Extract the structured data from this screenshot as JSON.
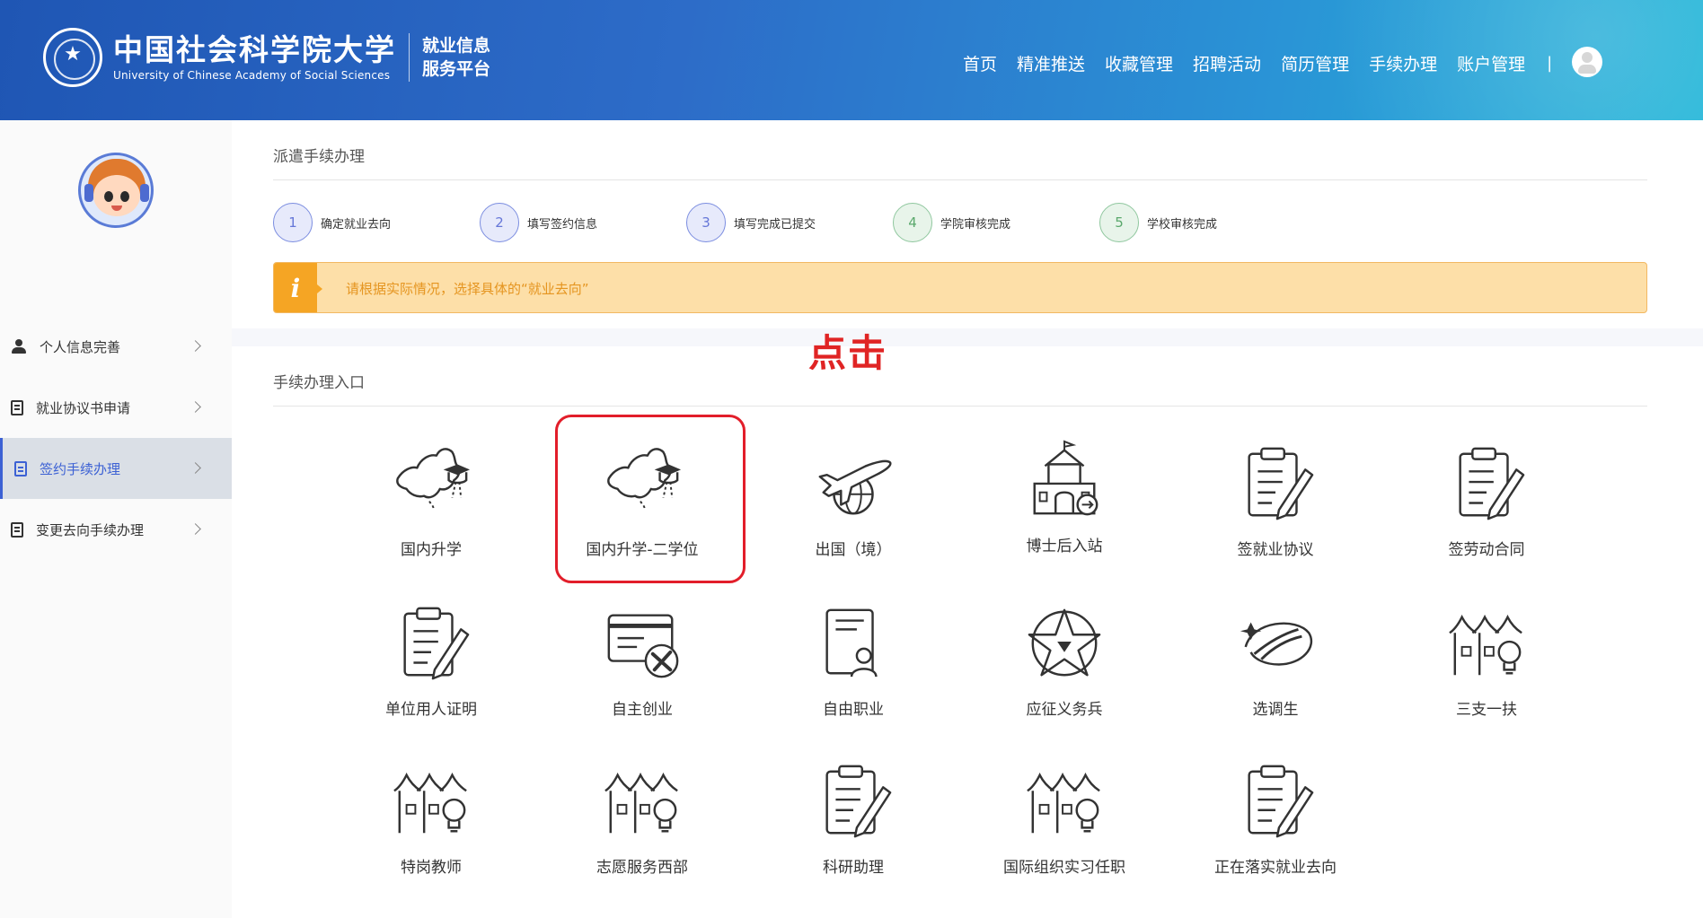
{
  "header": {
    "logo_cn": "中国社会科学院大学",
    "logo_en": "University of Chinese Academy of Social Sciences",
    "platform_line1": "就业信息",
    "platform_line2": "服务平台",
    "nav": [
      "首页",
      "精准推送",
      "收藏管理",
      "招聘活动",
      "简历管理",
      "手续办理",
      "账户管理"
    ],
    "separator": "|"
  },
  "sidebar": {
    "items": [
      {
        "label": "个人信息完善",
        "icon": "user-icon",
        "active": false
      },
      {
        "label": "就业协议书申请",
        "icon": "document-icon",
        "active": false
      },
      {
        "label": "签约手续办理",
        "icon": "clipboard-icon",
        "active": true
      },
      {
        "label": "变更去向手续办理",
        "icon": "document-icon",
        "active": false
      }
    ]
  },
  "dispatch": {
    "title": "派遣手续办理",
    "steps": [
      {
        "num": "1",
        "label": "确定就业去向",
        "status": "current"
      },
      {
        "num": "2",
        "label": "填写签约信息",
        "status": "current"
      },
      {
        "num": "3",
        "label": "填写完成已提交",
        "status": "current"
      },
      {
        "num": "4",
        "label": "学院审核完成",
        "status": "pending"
      },
      {
        "num": "5",
        "label": "学校审核完成",
        "status": "pending"
      }
    ],
    "alert_icon": "i",
    "alert_text": "请根据实际情况，选择具体的“就业去向”"
  },
  "annotation": {
    "click_text": "点击"
  },
  "entries": {
    "title": "手续办理入口",
    "items": [
      {
        "label": "国内升学",
        "icon": "china-map-graduation-icon"
      },
      {
        "label": "国内升学-二学位",
        "icon": "china-map-graduation-icon"
      },
      {
        "label": "出国（境）",
        "icon": "airplane-globe-icon"
      },
      {
        "label": "博士后入站",
        "icon": "institution-building-icon"
      },
      {
        "label": "签就业协议",
        "icon": "clipboard-pen-icon"
      },
      {
        "label": "签劳动合同",
        "icon": "clipboard-pen-icon"
      },
      {
        "label": "单位用人证明",
        "icon": "clipboard-pen-icon"
      },
      {
        "label": "自主创业",
        "icon": "card-tools-icon"
      },
      {
        "label": "自由职业",
        "icon": "id-card-person-icon"
      },
      {
        "label": "应征义务兵",
        "icon": "military-star-icon"
      },
      {
        "label": "选调生",
        "icon": "swoosh-emblem-icon"
      },
      {
        "label": "三支一扶",
        "icon": "village-lightbulb-icon"
      },
      {
        "label": "特岗教师",
        "icon": "village-lightbulb-icon"
      },
      {
        "label": "志愿服务西部",
        "icon": "village-lightbulb-icon"
      },
      {
        "label": "科研助理",
        "icon": "clipboard-pen-icon"
      },
      {
        "label": "国际组织实习任职",
        "icon": "village-lightbulb-icon"
      },
      {
        "label": "正在落实就业去向",
        "icon": "clipboard-pen-icon"
      }
    ]
  },
  "colors": {
    "header_start": "#1f56b4",
    "header_end": "#22b6d8",
    "active_blue": "#3c61d4",
    "alert_bg": "#fddfa8",
    "alert_accent": "#f5a524",
    "highlight_red": "#e21e2a"
  }
}
